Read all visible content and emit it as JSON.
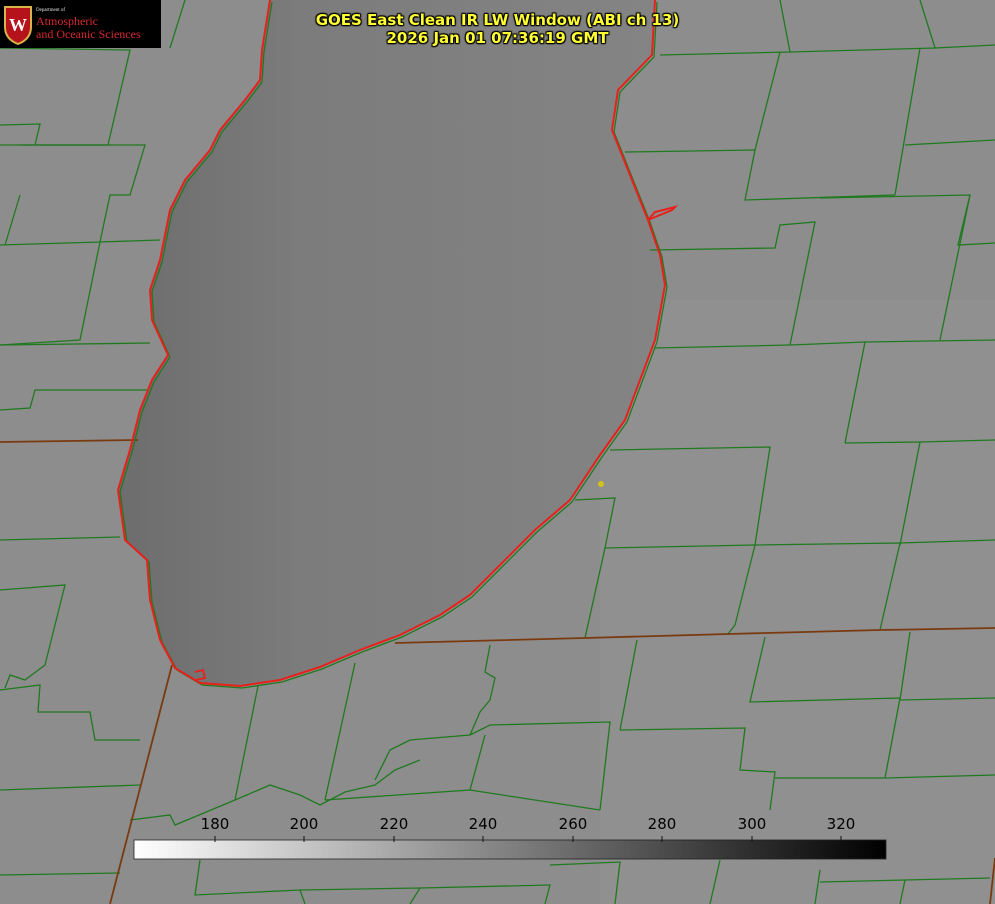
{
  "header": {
    "title_line1": "GOES East Clean IR LW Window (ABI ch 13)",
    "title_line2": "2026 Jan 01 07:36:19 GMT"
  },
  "logo": {
    "dept_text": "Department of",
    "line1": "Atmospheric",
    "line2": "and Oceanic Sciences",
    "seal_letter": "W"
  },
  "colorbar": {
    "ticks": [
      "180",
      "200",
      "220",
      "240",
      "260",
      "280",
      "300",
      "320"
    ],
    "colormap": "grayscale, white (cold) to black (warm)"
  },
  "colors": {
    "background_land": "#8e8e8e",
    "lake_surface": "#7a7a7a",
    "county_lines": "#1f7a1f",
    "state_lines": "#7a3a10",
    "coastline": "#e8201c",
    "title_text": "#ffff33",
    "station_marker": "#d4c21a"
  }
}
